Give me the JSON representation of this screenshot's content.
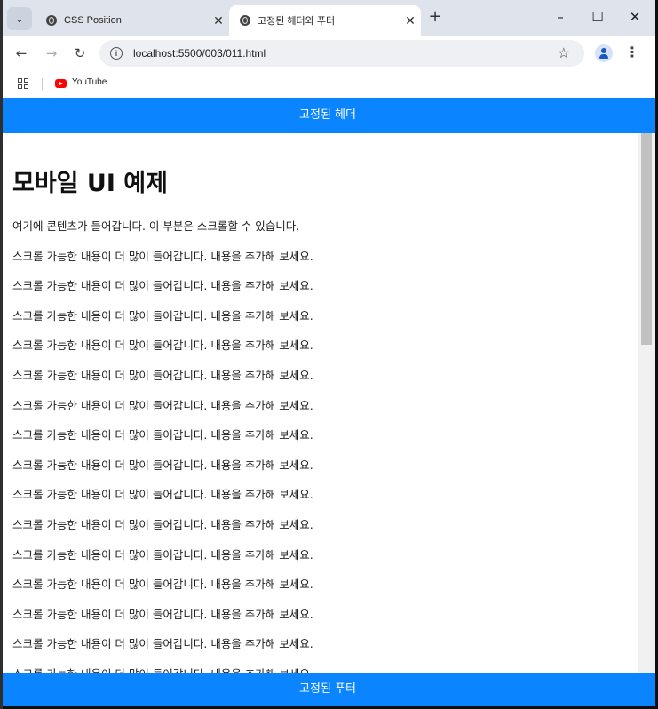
{
  "browser": {
    "tabs": [
      {
        "title": "CSS Position",
        "close": "✕"
      },
      {
        "title": "고정된 헤더와 푸터",
        "close": "✕"
      }
    ],
    "new_tab": "+",
    "window_controls": {
      "minimize": "–",
      "maximize": "☐",
      "close": "✕"
    },
    "address": "localhost:5500/003/011.html",
    "bookmarks": [
      {
        "label": "YouTube"
      }
    ]
  },
  "page": {
    "header": "고정된 헤더",
    "footer": "고정된 푸터",
    "title": "모바일 UI 예제",
    "intro": "여기에 콘텐츠가 들어갑니다. 이 부분은 스크롤할 수 있습니다.",
    "paragraphs": [
      "스크롤 가능한 내용이 더 많이 들어갑니다. 내용을 추가해 보세요.",
      "스크롤 가능한 내용이 더 많이 들어갑니다. 내용을 추가해 보세요.",
      "스크롤 가능한 내용이 더 많이 들어갑니다. 내용을 추가해 보세요.",
      "스크롤 가능한 내용이 더 많이 들어갑니다. 내용을 추가해 보세요.",
      "스크롤 가능한 내용이 더 많이 들어갑니다. 내용을 추가해 보세요.",
      "스크롤 가능한 내용이 더 많이 들어갑니다. 내용을 추가해 보세요.",
      "스크롤 가능한 내용이 더 많이 들어갑니다. 내용을 추가해 보세요.",
      "스크롤 가능한 내용이 더 많이 들어갑니다. 내용을 추가해 보세요.",
      "스크롤 가능한 내용이 더 많이 들어갑니다. 내용을 추가해 보세요.",
      "스크롤 가능한 내용이 더 많이 들어갑니다. 내용을 추가해 보세요.",
      "스크롤 가능한 내용이 더 많이 들어갑니다. 내용을 추가해 보세요.",
      "스크롤 가능한 내용이 더 많이 들어갑니다. 내용을 추가해 보세요.",
      "스크롤 가능한 내용이 더 많이 들어갑니다. 내용을 추가해 보세요.",
      "스크롤 가능한 내용이 더 많이 들어갑니다. 내용을 추가해 보세요.",
      "스크롤 가능한 내용이 더 많이 들어갑니다. 내용을 추가해 보세요."
    ],
    "accent_color": "#0a84ff"
  }
}
